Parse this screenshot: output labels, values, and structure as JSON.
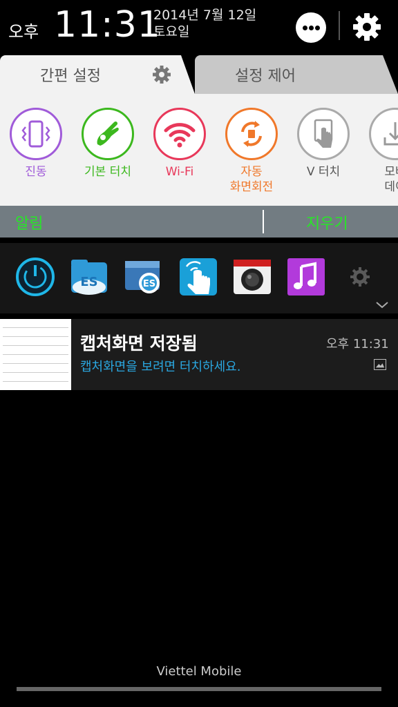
{
  "header": {
    "ampm": "오후",
    "time": "11:31",
    "date": "2014년 7월 12일",
    "weekday": "토요일"
  },
  "tabs": [
    {
      "label": "간편 설정",
      "active": true
    },
    {
      "label": "설정 제어",
      "active": false
    }
  ],
  "quick_settings": [
    {
      "label": "진동",
      "icon": "vibrate-icon",
      "color": "#a05bd9"
    },
    {
      "label": "기본 터치",
      "icon": "touch-hand-icon",
      "color": "#3cb81e"
    },
    {
      "label": "Wi-Fi",
      "icon": "wifi-icon",
      "color": "#e8385a"
    },
    {
      "label": "자동",
      "label2": "화면회전",
      "icon": "auto-rotate-icon",
      "color": "#f0782a"
    },
    {
      "label": "V 터치",
      "icon": "v-touch-icon",
      "color": "#888888"
    },
    {
      "label": "모바",
      "label2": "데이",
      "icon": "mobile-data-icon",
      "color": "#888888"
    }
  ],
  "notice": {
    "left": "알림",
    "right": "지우기"
  },
  "apps": [
    {
      "icon": "power-app-icon"
    },
    {
      "icon": "es-file-explorer-icon"
    },
    {
      "icon": "es-settings-icon"
    },
    {
      "icon": "touch-app-icon"
    },
    {
      "icon": "camera-app-icon"
    },
    {
      "icon": "music-app-icon"
    },
    {
      "icon": "gear-app-icon"
    }
  ],
  "notification": {
    "title": "캡처화면 저장됨",
    "time": "오후 11:31",
    "subtitle": "캡처화면을 보려면 터치하세요."
  },
  "carrier": "Viettel Mobile"
}
